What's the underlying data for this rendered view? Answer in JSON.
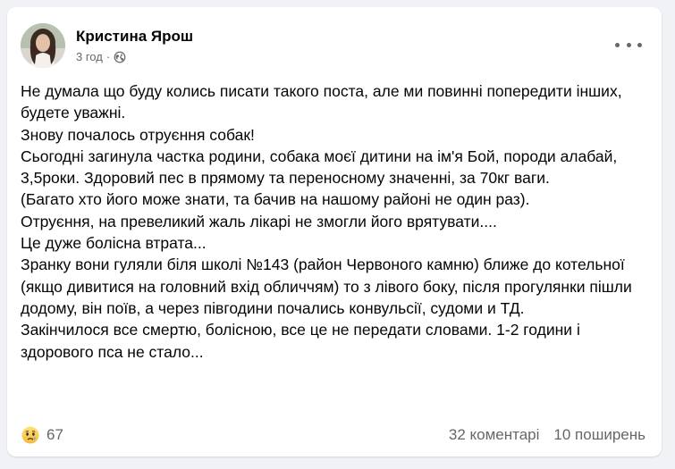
{
  "post": {
    "author": "Кристина Ярош",
    "time": "3 год",
    "time_sep": "·",
    "privacy_icon": "globe-icon",
    "more_icon": "more-options-icon",
    "paragraphs": [
      "Не думала що буду колись писати такого поста, але ми повинні попередити інших, будете уважні.",
      "Знову почалось отруєння собак!",
      "Сьогодні загинула частка родини, собака моєї дитини на ім'я Бой, породи алабай, 3,5роки. Здоровий пес в прямому та переносному значенні, за 70кг ваги.",
      "(Багато хто його може знати, та бачив на нашому районі не один раз).",
      "Отруєння, на превеликий жаль лікарі не змогли його врятувати....",
      "Це дуже болісна втрата...",
      "Зранку вони гуляли біля школі №143 (район Червоного камню) ближе до котельної (якщо дивитися на головний вхід обличчям) то з лівого боку, після прогулянки пішли додому, він поїв, а через півгодини почались конвульсії, судоми и ТД.",
      "Закінчилося все смертю, болісною, все це не передати словами. 1-2 години і здорового пса не стало..."
    ]
  },
  "footer": {
    "reaction_icon": "sad-reaction-icon",
    "reaction_count": "67",
    "comments": "32 коментарі",
    "shares": "10 поширень"
  }
}
